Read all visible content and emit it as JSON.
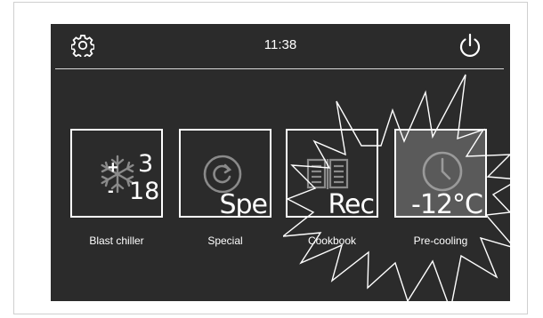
{
  "header": {
    "time": "11:38",
    "settings_icon": "gear-icon",
    "power_icon": "power-icon"
  },
  "tiles": [
    {
      "label": "Blast chiller",
      "icon": "snowflake-icon",
      "value_top": "3",
      "value_bottom": "18",
      "sign_top": "+",
      "sign_bottom": "-"
    },
    {
      "label": "Special",
      "icon": "circular-arrow-icon",
      "value": "Spe"
    },
    {
      "label": "Cookbook",
      "icon": "book-icon",
      "value": "Rec"
    },
    {
      "label": "Pre-cooling",
      "icon": "clock-icon",
      "value": "-12°C",
      "active": true
    }
  ],
  "colors": {
    "screen_bg": "#2b2b2b",
    "text": "#ffffff",
    "active_tile": "#5a5a5a",
    "icon_gray": "#8a8a8a"
  }
}
